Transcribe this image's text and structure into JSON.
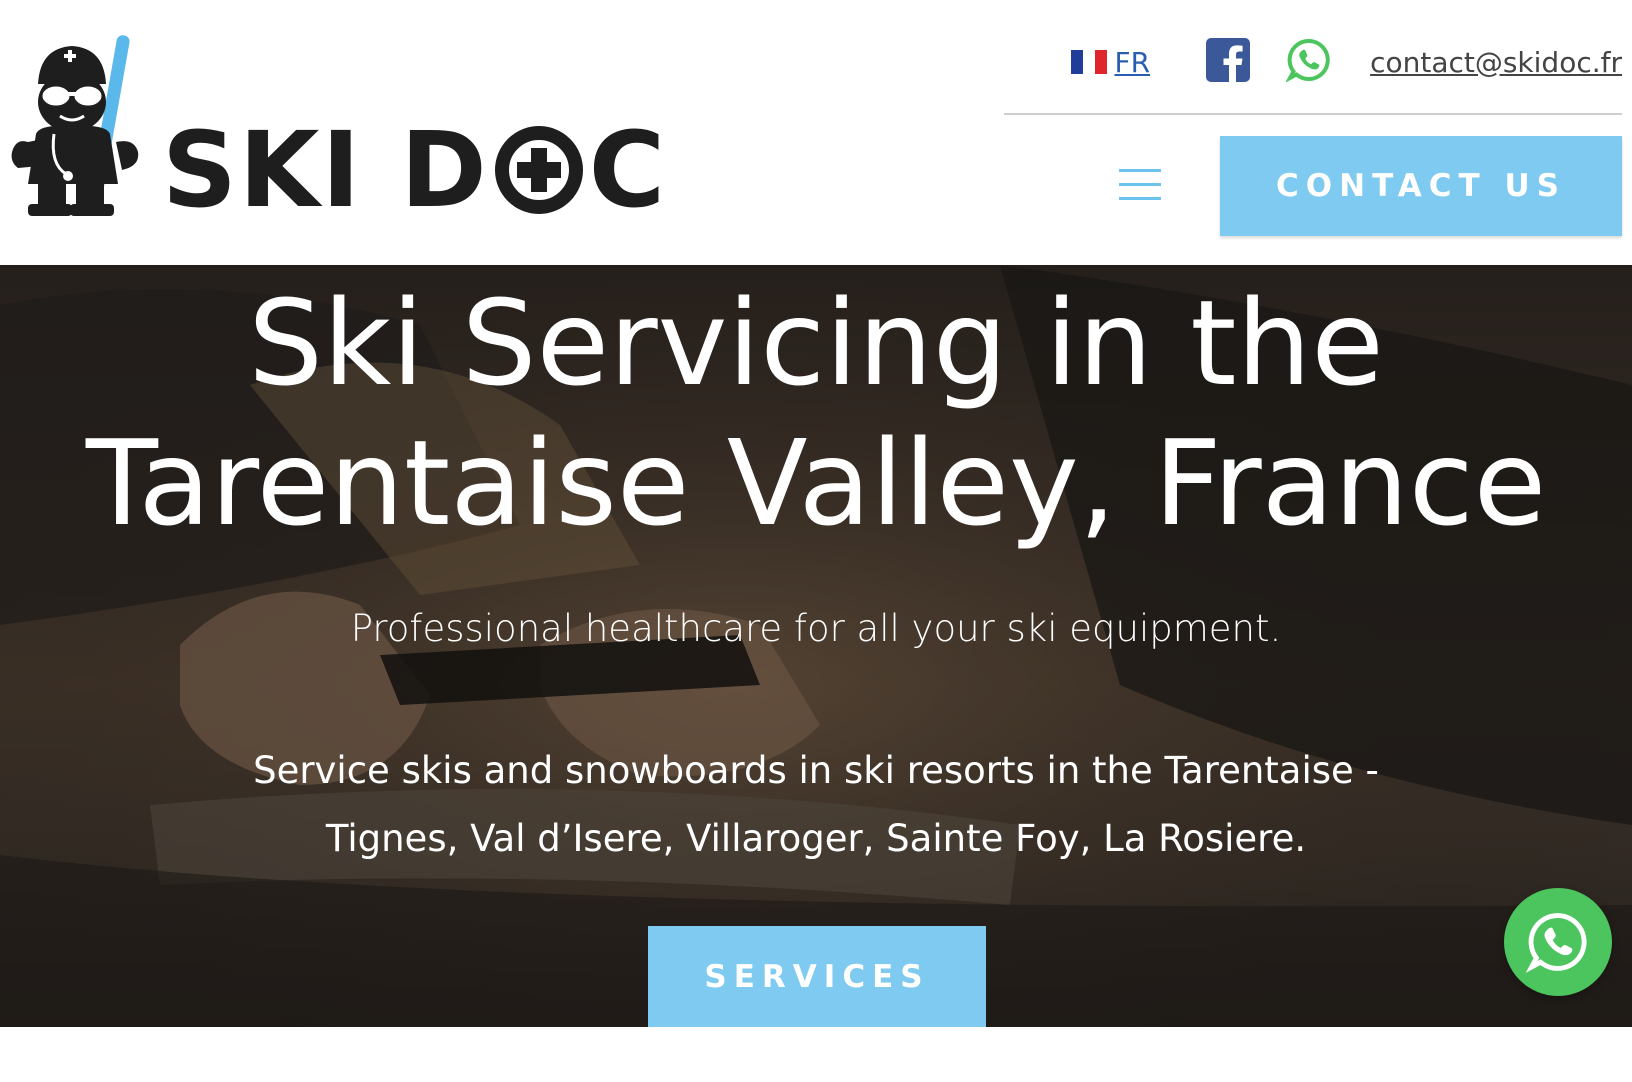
{
  "brand": {
    "name": "SKI DOC",
    "name_start": "SKI D",
    "name_end": "C"
  },
  "topbar": {
    "language": "FR",
    "email": "contact@skidoc.fr"
  },
  "nav": {
    "contact_label": "CONTACT US"
  },
  "hero": {
    "title_line1": "Ski Servicing in the",
    "title_line2": "Tarentaise Valley, France",
    "subtitle": "Professional healthcare for all your ski equipment.",
    "description_line1": "Service skis and snowboards in ski resorts in the Tarentaise -",
    "description_line2": "Tignes, Val d’Isere, Villaroger, Sainte Foy, La Rosiere.",
    "services_label": "SERVICES"
  },
  "icons": {
    "flag": "france-flag-icon",
    "facebook": "facebook-icon",
    "whatsapp": "whatsapp-icon",
    "menu": "hamburger-menu-icon"
  },
  "colors": {
    "accent": "#7fcaf0",
    "facebook": "#3b5998",
    "whatsapp": "#4dc55e",
    "logo_dark": "#1e1e1e",
    "link_blue": "#2a5db0"
  }
}
